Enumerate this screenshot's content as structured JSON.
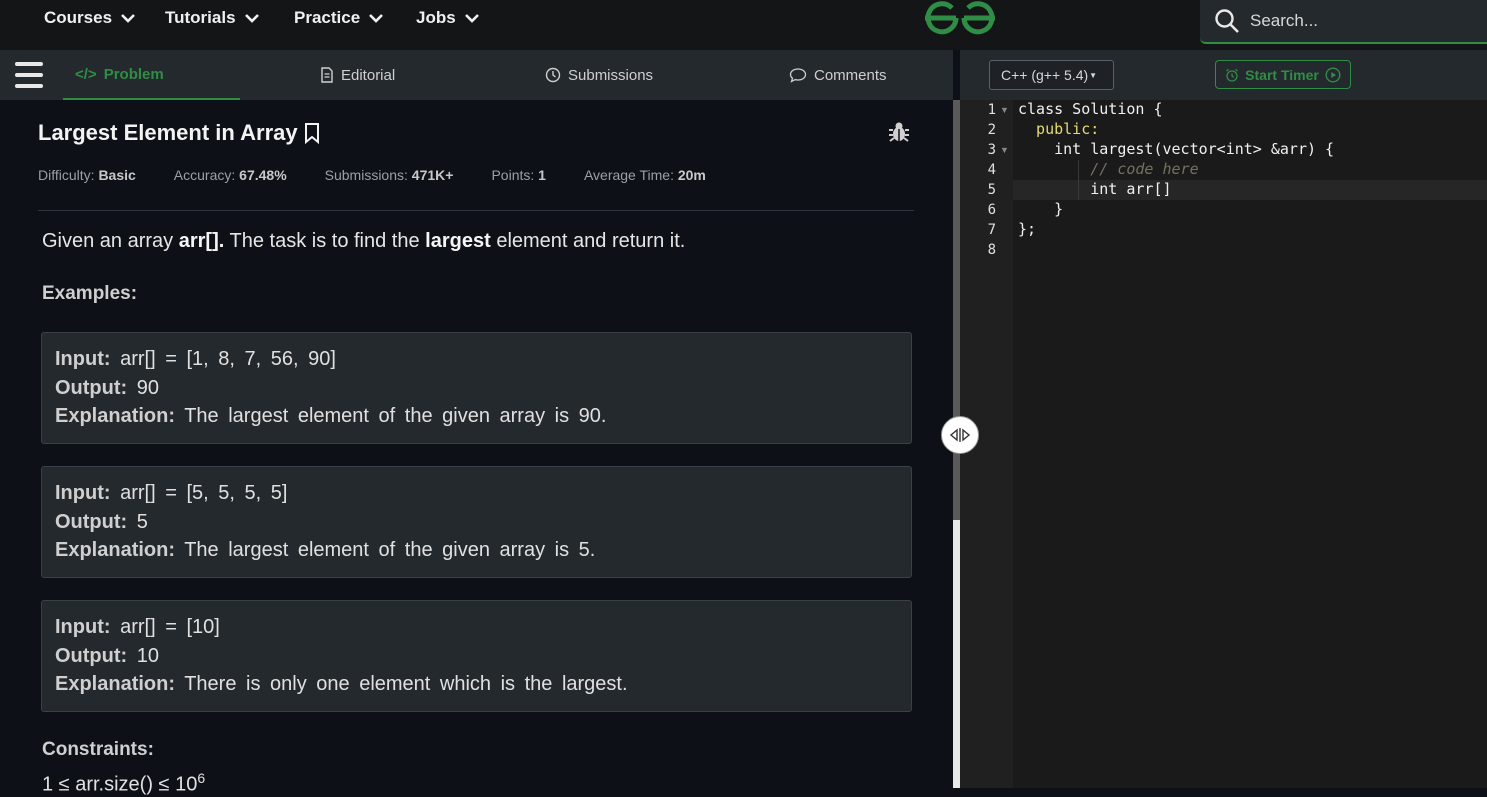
{
  "nav": {
    "items": [
      "Courses",
      "Tutorials",
      "Practice",
      "Jobs"
    ],
    "search_placeholder": "Search..."
  },
  "tabs": {
    "problem": "Problem",
    "editorial": "Editorial",
    "submissions": "Submissions",
    "comments": "Comments"
  },
  "problem": {
    "title": "Largest Element in Array",
    "meta": {
      "difficulty_label": "Difficulty:",
      "difficulty": "Basic",
      "accuracy_label": "Accuracy:",
      "accuracy": "67.48%",
      "submissions_label": "Submissions:",
      "submissions": "471K+",
      "points_label": "Points:",
      "points": "1",
      "avg_time_label": "Average Time:",
      "avg_time": "20m"
    },
    "desc_parts": [
      "Given an array ",
      "arr[].",
      " The task is to find the ",
      "largest",
      " element and return it."
    ],
    "examples_heading": "Examples:",
    "labels": {
      "input": "Input:",
      "output": "Output:",
      "explanation": "Explanation:"
    },
    "examples": [
      {
        "input": "arr[] = [1, 8, 7, 56, 90]",
        "output": "90",
        "explanation": "The largest element of the given array is 90."
      },
      {
        "input": "arr[] = [5, 5, 5, 5]",
        "output": "5",
        "explanation": "The largest element of the given array is 5."
      },
      {
        "input": "arr[] = [10]",
        "output": "10",
        "explanation": "There is only one element which is the largest."
      }
    ],
    "constraints_heading": "Constraints:",
    "constraint_text": "1 ≤ arr.size() ≤ 10",
    "constraint_exp": "6"
  },
  "editor": {
    "language": "C++ (g++ 5.4)",
    "timer_label": "Start Timer",
    "line_numbers": [
      "1",
      "2",
      "3",
      "4",
      "5",
      "6",
      "7",
      "8"
    ],
    "lines": [
      "class Solution {",
      "  public:",
      "    int largest(vector<int> &arr) {",
      "        // code here",
      "        int arr[]",
      "    }",
      "};",
      ""
    ]
  },
  "colors": {
    "accent": "#2f8d46",
    "bg": "#0d1117",
    "panel": "#24292e"
  }
}
